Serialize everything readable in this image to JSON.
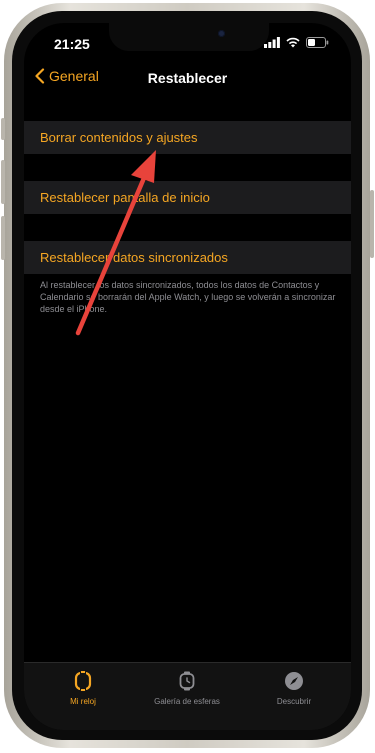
{
  "status_bar": {
    "time": "21:25"
  },
  "nav": {
    "back_label": "General",
    "title": "Restablecer"
  },
  "options": [
    {
      "label": "Borrar contenidos y ajustes"
    },
    {
      "label": "Restablecer pantalla de inicio"
    },
    {
      "label": "Restablecer datos sincronizados"
    }
  ],
  "footnote": "Al restablecer los datos sincronizados, todos los datos de Contactos y Calendario se borrarán del Apple Watch, y luego se volverán a sincronizar desde el iPhone.",
  "tab_bar": {
    "tabs": [
      {
        "label": "Mi reloj",
        "icon": "watch-icon",
        "active": true
      },
      {
        "label": "Galería de esferas",
        "icon": "watch-face-icon",
        "active": false
      },
      {
        "label": "Descubrir",
        "icon": "compass-icon",
        "active": false
      }
    ]
  },
  "colors": {
    "accent": "#f5a623",
    "background": "#000000",
    "cell": "#1c1c1e",
    "annotation_arrow": "#e8433b"
  }
}
